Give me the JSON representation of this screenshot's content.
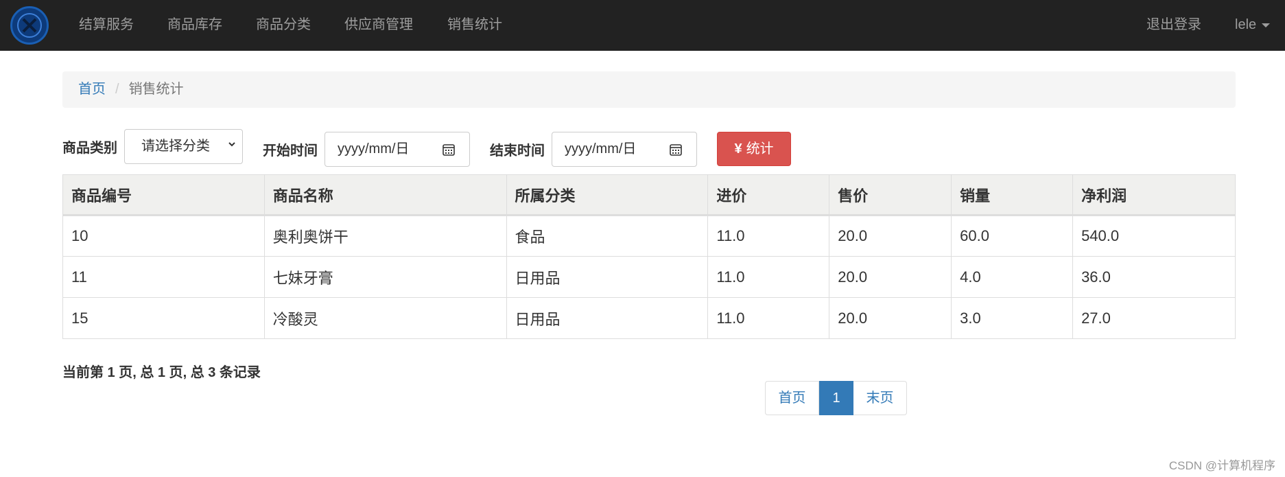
{
  "nav": {
    "items": [
      "结算服务",
      "商品库存",
      "商品分类",
      "供应商管理",
      "销售统计"
    ],
    "logout": "退出登录",
    "user": "lele"
  },
  "breadcrumb": {
    "home": "首页",
    "current": "销售统计"
  },
  "filters": {
    "category_label": "商品类别",
    "category_value": "请选择分类",
    "start_label": "开始时间",
    "start_value": "yyyy/mm/日",
    "end_label": "结束时间",
    "end_value": "yyyy/mm/日",
    "submit_label": "统计",
    "submit_icon": "¥"
  },
  "table": {
    "headers": [
      "商品编号",
      "商品名称",
      "所属分类",
      "进价",
      "售价",
      "销量",
      "净利润"
    ],
    "rows": [
      [
        "10",
        "奥利奥饼干",
        "食品",
        "11.0",
        "20.0",
        "60.0",
        "540.0"
      ],
      [
        "11",
        "七妹牙膏",
        "日用品",
        "11.0",
        "20.0",
        "4.0",
        "36.0"
      ],
      [
        "15",
        "冷酸灵",
        "日用品",
        "11.0",
        "20.0",
        "3.0",
        "27.0"
      ]
    ]
  },
  "pagination": {
    "info": "当前第 1 页, 总 1 页, 总 3 条记录",
    "first": "首页",
    "current": "1",
    "last": "末页"
  },
  "watermark": "CSDN @计算机程序",
  "colors": {
    "navbar": "#222222",
    "link": "#337ab7",
    "danger": "#d9534f"
  }
}
